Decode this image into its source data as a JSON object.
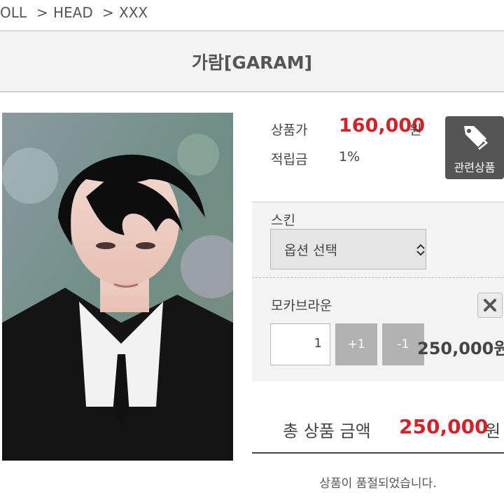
{
  "breadcrumb": {
    "items": [
      "OLL",
      "HEAD",
      "XXX"
    ],
    "separator": ">"
  },
  "product": {
    "title": "가람[GARAM]",
    "price_label": "상품가",
    "price_value": "160,000",
    "price_unit": "원",
    "points_label": "적립금",
    "points_value": "1%",
    "related_button": "관련상품",
    "image_icon": "product-photo"
  },
  "options": {
    "skin_label": "스킨",
    "skin_select_value": "옵션 선택",
    "selected_item": {
      "name": "모카브라운",
      "quantity": "1",
      "plus_label": "+1",
      "minus_label": "-1",
      "line_price": "250,000원"
    }
  },
  "total": {
    "label": "총 상품 금액",
    "value": "250,000",
    "unit": "원"
  },
  "status": {
    "soldout_text": "상품이 품절되었습니다."
  },
  "colors": {
    "accent_price": "#d2232a",
    "button_dark": "#555555",
    "button_gray": "#b2b2b2"
  }
}
